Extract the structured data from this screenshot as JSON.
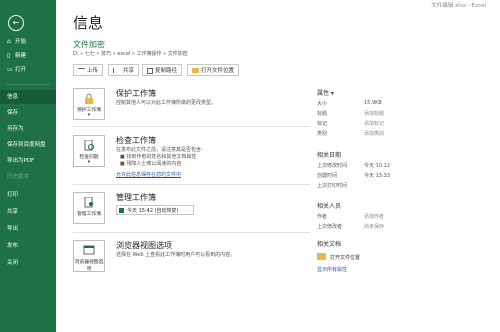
{
  "window": {
    "title": "文件编辑.xlsx  -  Excel"
  },
  "sidebar": {
    "back_icon": "arrow-left-icon",
    "items": [
      {
        "label": "开始",
        "icon": "home-icon"
      },
      {
        "label": "新建",
        "icon": "new-file-icon"
      },
      {
        "label": "打开",
        "icon": "folder-open-icon"
      },
      {
        "label": "信息"
      },
      {
        "label": "保存"
      },
      {
        "label": "另存为"
      },
      {
        "label": "保存到百度网盘"
      },
      {
        "label": "导出为PDF"
      },
      {
        "label": "历史版本"
      },
      {
        "label": "打印"
      },
      {
        "label": "共享"
      },
      {
        "label": "导出"
      },
      {
        "label": "发布"
      },
      {
        "label": "关闭"
      }
    ]
  },
  "main": {
    "page_title": "信息",
    "doc_title": "文件加密",
    "doc_path": "D: » 七七 » 技巧 » excel » 工作簿操作 » 文件加密",
    "buttons": {
      "upload": "上传",
      "share": "共享",
      "copy_path": "复制路径",
      "open_location": "打开文件位置"
    },
    "sections": {
      "protect": {
        "tile": "保护工作簿",
        "title": "保护工作簿",
        "desc": "控制其他人可以对此工作簿所做的更改类型。"
      },
      "inspect": {
        "tile": "检查问题",
        "title": "检查工作簿",
        "desc": "在发布此文件之前，请注意其是否包含:",
        "bullets": [
          "■ 找到作者的姓名和其他文档属性",
          "■ 残障人士难以阅读的内容"
        ],
        "link": "允许此信息保存在您的文件中"
      },
      "manage": {
        "tile": "管理工作簿",
        "title": "管理工作簿",
        "version": "今天 15:42 (自动恢复)"
      },
      "browser": {
        "tile": "浏览器视图选项",
        "title": "浏览器视图选项",
        "desc": "选择在 Web 上查看此工作簿时用户可以看到的内容。"
      }
    }
  },
  "properties": {
    "heading": "属性 ▾",
    "rows": [
      {
        "label": "大小",
        "value": "15.9KB"
      },
      {
        "label": "标题",
        "value": "添加标题"
      },
      {
        "label": "标记",
        "value": "添加标记"
      },
      {
        "label": "类别",
        "value": "添加类别"
      }
    ],
    "dates_heading": "相关日期",
    "dates": [
      {
        "label": "上次修改时间",
        "value": "今天 10:12"
      },
      {
        "label": "创建时间",
        "value": "今天 13:33"
      },
      {
        "label": "上次打印时间",
        "value": ""
      }
    ],
    "people_heading": "相关人员",
    "people": [
      {
        "label": "作者",
        "value": "添加作者"
      },
      {
        "label": "上次修改者",
        "value": "尚未保存"
      }
    ],
    "docs_heading": "相关文档",
    "open_location": "打开文件位置",
    "show_all": "显示所有属性"
  }
}
